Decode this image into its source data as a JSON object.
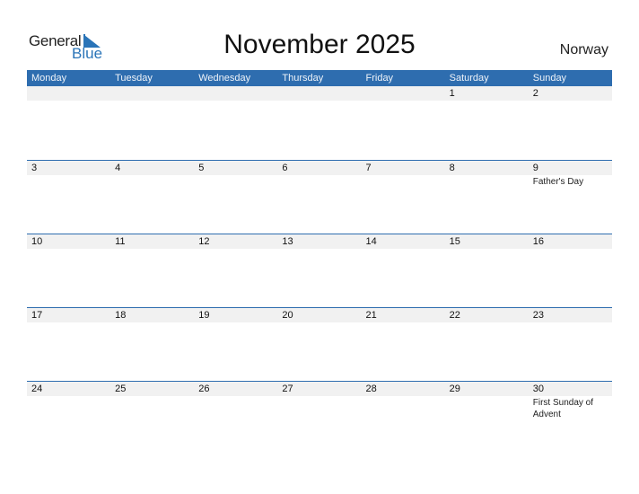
{
  "logo": {
    "general": "General",
    "blue": "Blue",
    "accent_color": "#2a74b8"
  },
  "title": "November 2025",
  "country": "Norway",
  "header_color": "#2e6daf",
  "weekdays": [
    "Monday",
    "Tuesday",
    "Wednesday",
    "Thursday",
    "Friday",
    "Saturday",
    "Sunday"
  ],
  "weeks": [
    [
      {
        "d": ""
      },
      {
        "d": ""
      },
      {
        "d": ""
      },
      {
        "d": ""
      },
      {
        "d": ""
      },
      {
        "d": "1"
      },
      {
        "d": "2"
      }
    ],
    [
      {
        "d": "3"
      },
      {
        "d": "4"
      },
      {
        "d": "5"
      },
      {
        "d": "6"
      },
      {
        "d": "7"
      },
      {
        "d": "8"
      },
      {
        "d": "9",
        "ev": "Father's Day"
      }
    ],
    [
      {
        "d": "10"
      },
      {
        "d": "11"
      },
      {
        "d": "12"
      },
      {
        "d": "13"
      },
      {
        "d": "14"
      },
      {
        "d": "15"
      },
      {
        "d": "16"
      }
    ],
    [
      {
        "d": "17"
      },
      {
        "d": "18"
      },
      {
        "d": "19"
      },
      {
        "d": "20"
      },
      {
        "d": "21"
      },
      {
        "d": "22"
      },
      {
        "d": "23"
      }
    ],
    [
      {
        "d": "24"
      },
      {
        "d": "25"
      },
      {
        "d": "26"
      },
      {
        "d": "27"
      },
      {
        "d": "28"
      },
      {
        "d": "29"
      },
      {
        "d": "30",
        "ev": "First Sunday of Advent"
      }
    ]
  ]
}
